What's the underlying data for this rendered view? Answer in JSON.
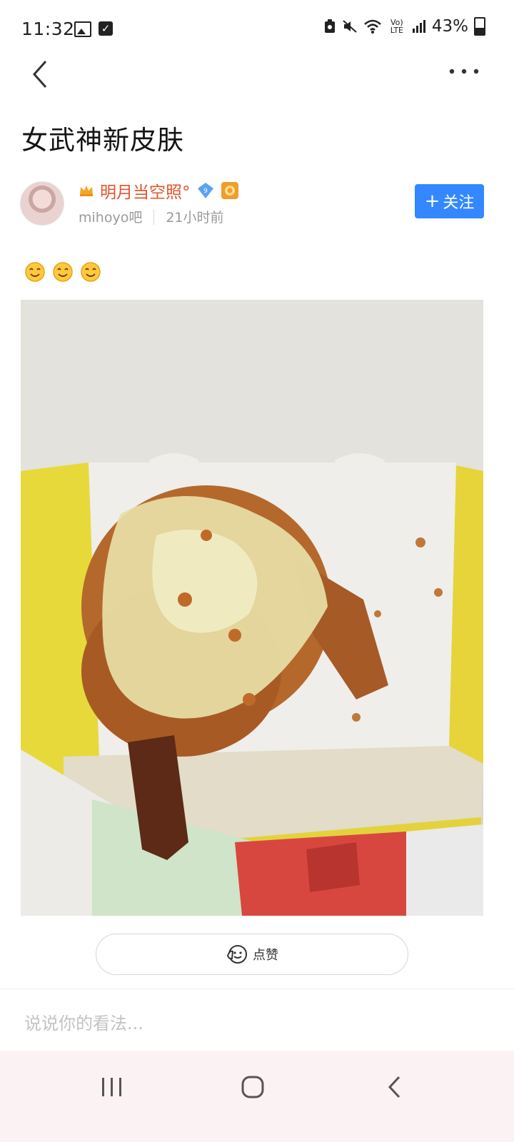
{
  "status_bar": {
    "time": "11:32",
    "network": "Vo) LTE",
    "battery": "43%",
    "battery_level": 0.43,
    "icons": [
      "gallery-icon",
      "check-box-icon",
      "alarm-icon",
      "mute-icon",
      "wifi-icon",
      "signal-icon",
      "battery-icon"
    ]
  },
  "nav": {
    "back_icon": "chevron-left-icon",
    "more_icon": "more-dots-icon"
  },
  "post": {
    "title": "女武神新皮肤",
    "emojis": [
      "smile-emoji",
      "smile-emoji",
      "smile-emoji"
    ]
  },
  "author": {
    "name": "明月当空照°",
    "level": "9",
    "forum": "mihoyo吧",
    "time_ago": "21小时前",
    "follow_label": "关注",
    "follow_plus": "+"
  },
  "actions": {
    "like_label": "点赞"
  },
  "comment": {
    "placeholder": "说说你的看法..."
  },
  "colors": {
    "accent": "#3388ff",
    "author_name": "#e0542a",
    "meta": "#9a9a9a"
  }
}
